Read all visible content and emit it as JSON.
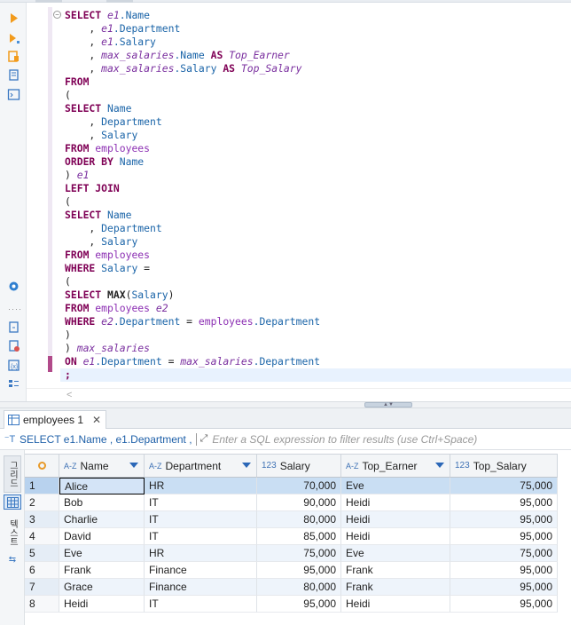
{
  "editor": {
    "lines": [
      [
        {
          "t": "SELECT ",
          "c": "kw"
        },
        {
          "t": "e1",
          "c": "al"
        },
        {
          "t": ".Name",
          "c": "col"
        }
      ],
      [
        {
          "t": "    , ",
          "c": "p"
        },
        {
          "t": "e1",
          "c": "al"
        },
        {
          "t": ".Department",
          "c": "col"
        }
      ],
      [
        {
          "t": "    , ",
          "c": "p"
        },
        {
          "t": "e1",
          "c": "al"
        },
        {
          "t": ".Salary",
          "c": "col"
        }
      ],
      [
        {
          "t": "    , ",
          "c": "p"
        },
        {
          "t": "max_salaries",
          "c": "al"
        },
        {
          "t": ".Name ",
          "c": "col"
        },
        {
          "t": "AS ",
          "c": "kw"
        },
        {
          "t": "Top_Earner",
          "c": "al"
        }
      ],
      [
        {
          "t": "    , ",
          "c": "p"
        },
        {
          "t": "max_salaries",
          "c": "al"
        },
        {
          "t": ".Salary ",
          "c": "col"
        },
        {
          "t": "AS ",
          "c": "kw"
        },
        {
          "t": "Top_Salary",
          "c": "al"
        }
      ],
      [
        {
          "t": "FROM",
          "c": "kw"
        }
      ],
      [
        {
          "t": "(",
          "c": "p"
        }
      ],
      [
        {
          "t": "SELECT ",
          "c": "kw"
        },
        {
          "t": "Name",
          "c": "col"
        }
      ],
      [
        {
          "t": "    , ",
          "c": "p"
        },
        {
          "t": "Department",
          "c": "col"
        }
      ],
      [
        {
          "t": "    , ",
          "c": "p"
        },
        {
          "t": "Salary",
          "c": "col"
        }
      ],
      [
        {
          "t": "FROM ",
          "c": "kw"
        },
        {
          "t": "employees",
          "c": "tb"
        }
      ],
      [
        {
          "t": "ORDER BY ",
          "c": "kw"
        },
        {
          "t": "Name",
          "c": "col"
        }
      ],
      [
        {
          "t": ") ",
          "c": "p"
        },
        {
          "t": "e1",
          "c": "al"
        }
      ],
      [
        {
          "t": "LEFT JOIN",
          "c": "kw"
        }
      ],
      [
        {
          "t": "(",
          "c": "p"
        }
      ],
      [
        {
          "t": "SELECT ",
          "c": "kw"
        },
        {
          "t": "Name",
          "c": "col"
        }
      ],
      [
        {
          "t": "    , ",
          "c": "p"
        },
        {
          "t": "Department",
          "c": "col"
        }
      ],
      [
        {
          "t": "    , ",
          "c": "p"
        },
        {
          "t": "Salary",
          "c": "col"
        }
      ],
      [
        {
          "t": "FROM ",
          "c": "kw"
        },
        {
          "t": "employees",
          "c": "tb"
        }
      ],
      [
        {
          "t": "WHERE ",
          "c": "kw"
        },
        {
          "t": "Salary",
          "c": "col"
        },
        {
          "t": " =",
          "c": "p"
        }
      ],
      [
        {
          "t": "(",
          "c": "p"
        }
      ],
      [
        {
          "t": "SELECT ",
          "c": "kw"
        },
        {
          "t": "MAX",
          "c": "fn"
        },
        {
          "t": "(",
          "c": "p"
        },
        {
          "t": "Salary",
          "c": "col"
        },
        {
          "t": ")",
          "c": "p"
        }
      ],
      [
        {
          "t": "FROM ",
          "c": "kw"
        },
        {
          "t": "employees ",
          "c": "tb"
        },
        {
          "t": "e2",
          "c": "al"
        }
      ],
      [
        {
          "t": "WHERE ",
          "c": "kw"
        },
        {
          "t": "e2",
          "c": "al"
        },
        {
          "t": ".Department",
          "c": "col"
        },
        {
          "t": " = ",
          "c": "p"
        },
        {
          "t": "employees",
          "c": "tb"
        },
        {
          "t": ".Department",
          "c": "col"
        }
      ],
      [
        {
          "t": ")",
          "c": "p"
        }
      ],
      [
        {
          "t": ") ",
          "c": "p"
        },
        {
          "t": "max_salaries",
          "c": "al"
        }
      ],
      [
        {
          "t": "ON ",
          "c": "kw"
        },
        {
          "t": "e1",
          "c": "al"
        },
        {
          "t": ".Department",
          "c": "col"
        },
        {
          "t": " = ",
          "c": "p"
        },
        {
          "t": "max_salaries",
          "c": "al"
        },
        {
          "t": ".Department",
          "c": "col"
        }
      ],
      [
        {
          "t": ";",
          "c": "kw"
        }
      ]
    ]
  },
  "results": {
    "tab_label": "employees 1",
    "filter": {
      "query_preview": "SELECT e1.Name , e1.Department ,",
      "placeholder": "Enter a SQL expression to filter results (use Ctrl+Space)"
    },
    "columns": [
      {
        "type": "A-Z",
        "name": "Name"
      },
      {
        "type": "A-Z",
        "name": "Department"
      },
      {
        "type": "123",
        "name": "Salary"
      },
      {
        "type": "A-Z",
        "name": "Top_Earner"
      },
      {
        "type": "123",
        "name": "Top_Salary"
      }
    ],
    "rows": [
      [
        "1",
        "Alice",
        "HR",
        "70,000",
        "Eve",
        "75,000"
      ],
      [
        "2",
        "Bob",
        "IT",
        "90,000",
        "Heidi",
        "95,000"
      ],
      [
        "3",
        "Charlie",
        "IT",
        "80,000",
        "Heidi",
        "95,000"
      ],
      [
        "4",
        "David",
        "IT",
        "85,000",
        "Heidi",
        "95,000"
      ],
      [
        "5",
        "Eve",
        "HR",
        "75,000",
        "Eve",
        "75,000"
      ],
      [
        "6",
        "Frank",
        "Finance",
        "95,000",
        "Frank",
        "95,000"
      ],
      [
        "7",
        "Grace",
        "Finance",
        "80,000",
        "Frank",
        "95,000"
      ],
      [
        "8",
        "Heidi",
        "IT",
        "95,000",
        "Heidi",
        "95,000"
      ]
    ],
    "side_labels": {
      "grid": "그리드",
      "text": "텍스트"
    }
  },
  "colors": {
    "keyword": "#7f0055",
    "column": "#1a64a8",
    "alias": "#7a2f9f",
    "table": "#8c2fb3",
    "selection": "#c9def3"
  }
}
